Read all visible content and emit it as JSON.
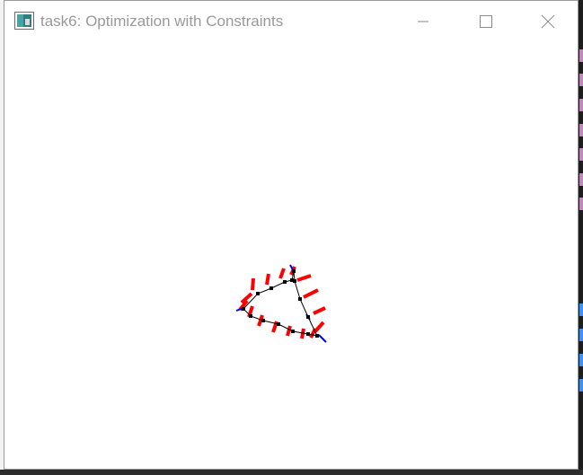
{
  "window": {
    "title": "task6: Optimization with Constraints",
    "controls": {
      "minimize": "minimize",
      "maximize": "maximize",
      "close": "close"
    }
  },
  "colors": {
    "titlebar_text": "#999999",
    "canvas_bg": "#ffffff",
    "normal_lines": "#ff0000",
    "tangent_lines": "#0000ff",
    "polygon": "#000000"
  },
  "icons": [
    "app-icon",
    "minimize-icon",
    "maximize-icon",
    "close-icon"
  ]
}
